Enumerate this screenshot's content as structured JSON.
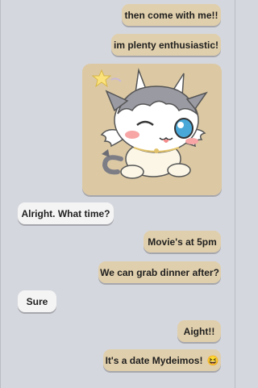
{
  "chat": {
    "messages": [
      {
        "side": "out",
        "text": "then come with me!!"
      },
      {
        "side": "out",
        "text": "im plenty enthusiastic!"
      },
      {
        "side": "out",
        "type": "sticker",
        "icon": "cat-dragon-wink-sticker"
      },
      {
        "side": "in",
        "text": "Alright. What time?"
      },
      {
        "side": "out",
        "text": "Movie's at 5pm"
      },
      {
        "side": "out",
        "text": "We can grab dinner after?"
      },
      {
        "side": "in",
        "text": "Sure"
      },
      {
        "side": "out",
        "text": "Aight!!"
      },
      {
        "side": "out",
        "text": "It's a date Mydeimos!",
        "emoji": "😆"
      }
    ]
  },
  "colors": {
    "background": "#d5d7de",
    "outgoing_bubble": "#e0cfac",
    "incoming_bubble": "#f4f4f4",
    "sticker_background": "#dcc9a4"
  }
}
